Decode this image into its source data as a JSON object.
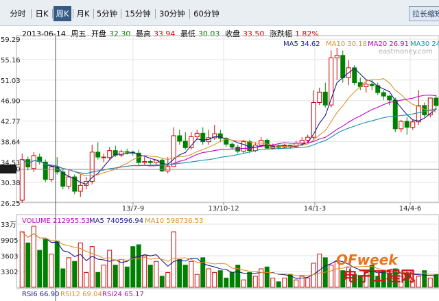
{
  "toolbar": {
    "tabs": [
      {
        "label": "分时",
        "active": false
      },
      {
        "label": "日K",
        "active": false
      },
      {
        "label": "周K",
        "active": true
      },
      {
        "label": "月K",
        "active": false
      },
      {
        "label": "5分钟",
        "active": false
      },
      {
        "label": "15分钟",
        "active": false
      },
      {
        "label": "30分钟",
        "active": false
      },
      {
        "label": "60分钟",
        "active": false
      }
    ],
    "zoom_button": "拉长缩短"
  },
  "info": {
    "date": "2013-06-14",
    "weekday": "周五",
    "open_label": "开盘",
    "open": "32.30",
    "high_label": "最高",
    "high": "33.94",
    "low_label": "最低",
    "low": "30.03",
    "close_label": "收盘",
    "close": "33.50",
    "change_label": "涨跌幅",
    "change": "1.82%"
  },
  "colors": {
    "up": "#d00000",
    "down": "#008000",
    "ma5": "#1a1a8c",
    "ma10": "#e0902a",
    "ma20": "#c000c0",
    "ma30": "#1a8fb0"
  },
  "watermark": {
    "brand": "OFweek",
    "site": "电子工程网",
    "top": "eastmoney.com"
  },
  "chart_data": {
    "type": "candlestick",
    "price_axis": {
      "ticks": [
        "59.29",
        "55.16",
        "51.03",
        "46.90",
        "42.77",
        "38.64",
        "34.51",
        "30.38",
        "26.25"
      ],
      "current": "33.50",
      "ylim": [
        26.25,
        59.29
      ]
    },
    "x_tick_labels": [
      "13/7-9",
      "13/10-12",
      "14/1-3",
      "14/4-6"
    ],
    "legend": [
      {
        "label": "MA5",
        "value": "34.62"
      },
      {
        "label": "MA10",
        "value": "30.18"
      },
      {
        "label": "MA20",
        "value": "26.91"
      },
      {
        "label": "MA30",
        "value": "24"
      }
    ],
    "candles": [
      [
        26.8,
        35.0,
        26.3,
        36.2
      ],
      [
        35.0,
        33.5,
        32.8,
        35.6
      ],
      [
        33.2,
        35.8,
        32.5,
        36.5
      ],
      [
        35.5,
        34.6,
        34.0,
        36.2
      ],
      [
        34.5,
        31.0,
        30.5,
        35.0
      ],
      [
        31.0,
        33.5,
        30.5,
        34.0
      ],
      [
        33.5,
        32.5,
        32.0,
        35.5
      ],
      [
        32.5,
        29.6,
        29.0,
        33.0
      ],
      [
        29.6,
        31.5,
        29.0,
        33.0
      ],
      [
        31.5,
        28.6,
        28.0,
        32.0
      ],
      [
        28.6,
        29.8,
        27.5,
        32.0
      ],
      [
        29.8,
        30.6,
        29.0,
        31.5
      ],
      [
        30.6,
        36.5,
        30.0,
        38.0
      ],
      [
        36.5,
        35.5,
        35.0,
        38.5
      ],
      [
        35.5,
        35.5,
        34.5,
        36.2
      ],
      [
        35.4,
        36.8,
        35.0,
        37.5
      ],
      [
        36.8,
        35.9,
        35.5,
        37.8
      ],
      [
        35.9,
        36.6,
        35.5,
        37.0
      ],
      [
        36.6,
        36.5,
        36.0,
        37.2
      ],
      [
        36.5,
        36.3,
        35.8,
        36.8
      ],
      [
        36.3,
        34.4,
        33.8,
        37.0
      ],
      [
        34.4,
        34.6,
        34.0,
        35.5
      ],
      [
        34.6,
        34.4,
        34.0,
        35.0
      ],
      [
        34.4,
        34.9,
        34.0,
        35.0
      ],
      [
        34.9,
        32.7,
        32.5,
        35.2
      ],
      [
        32.7,
        33.6,
        32.2,
        35.5
      ],
      [
        33.6,
        39.8,
        33.5,
        41.5
      ],
      [
        39.8,
        38.7,
        38.0,
        41.0
      ],
      [
        38.7,
        37.4,
        37.0,
        40.5
      ],
      [
        37.4,
        39.6,
        37.0,
        40.5
      ],
      [
        39.6,
        40.3,
        39.0,
        41.0
      ],
      [
        40.3,
        38.6,
        38.0,
        41.5
      ],
      [
        38.6,
        39.4,
        38.0,
        41.0
      ],
      [
        39.4,
        40.2,
        39.0,
        42.0
      ],
      [
        40.2,
        39.3,
        38.5,
        41.0
      ],
      [
        39.3,
        38.1,
        37.5,
        39.5
      ],
      [
        38.1,
        37.5,
        37.0,
        38.5
      ],
      [
        37.5,
        36.7,
        36.3,
        38.0
      ],
      [
        36.7,
        38.6,
        36.3,
        39.0
      ],
      [
        38.6,
        36.8,
        36.3,
        39.0
      ],
      [
        36.8,
        37.9,
        36.5,
        38.5
      ],
      [
        37.9,
        38.9,
        37.5,
        39.5
      ],
      [
        38.9,
        37.3,
        37.0,
        39.2
      ],
      [
        37.3,
        37.6,
        37.0,
        38.2
      ],
      [
        37.6,
        37.5,
        37.0,
        38.0
      ],
      [
        37.5,
        37.9,
        37.2,
        38.2
      ],
      [
        37.9,
        37.6,
        37.2,
        38.0
      ],
      [
        37.6,
        38.3,
        37.3,
        38.8
      ],
      [
        38.3,
        38.9,
        38.0,
        39.5
      ],
      [
        38.9,
        39.5,
        38.5,
        40.0
      ],
      [
        39.5,
        46.5,
        39.0,
        49.0
      ],
      [
        46.5,
        48.6,
        46.0,
        49.5
      ],
      [
        48.6,
        46.0,
        45.5,
        50.5
      ],
      [
        46.0,
        55.5,
        45.5,
        57.0
      ],
      [
        55.5,
        56.0,
        51.0,
        57.5
      ],
      [
        56.0,
        51.5,
        50.5,
        57.0
      ],
      [
        51.5,
        53.5,
        50.0,
        55.0
      ],
      [
        53.5,
        50.5,
        50.0,
        54.0
      ],
      [
        50.5,
        49.7,
        49.0,
        51.5
      ],
      [
        49.7,
        50.2,
        48.5,
        51.0
      ],
      [
        50.2,
        49.9,
        49.0,
        51.0
      ],
      [
        49.9,
        48.5,
        48.0,
        50.5
      ],
      [
        48.5,
        47.8,
        47.0,
        49.0
      ],
      [
        47.8,
        47.0,
        46.0,
        48.0
      ],
      [
        47.0,
        41.2,
        40.5,
        47.5
      ],
      [
        41.2,
        42.7,
        40.5,
        43.0
      ],
      [
        42.7,
        41.5,
        40.0,
        43.5
      ],
      [
        41.5,
        42.6,
        41.0,
        43.0
      ],
      [
        42.6,
        45.9,
        42.0,
        49.0
      ],
      [
        45.9,
        44.0,
        43.5,
        46.5
      ],
      [
        44.0,
        47.4,
        43.5,
        47.5
      ],
      [
        47.4,
        45.9,
        45.0,
        48.0
      ]
    ],
    "volume": {
      "legend": [
        {
          "label": "VOLUME",
          "value": "212955.53"
        },
        {
          "label": "MA5",
          "value": "740596.94"
        },
        {
          "label": "MA10",
          "value": "598736.53"
        }
      ],
      "ticks": [
        "33万",
        "9905",
        "3603",
        "3302"
      ],
      "values": [
        30,
        24,
        33,
        20,
        26,
        18,
        25,
        10,
        16,
        14,
        24,
        8,
        22,
        8,
        12,
        20,
        12,
        15,
        11,
        22,
        23,
        17,
        12,
        14,
        6,
        8,
        30,
        15,
        12,
        14,
        7,
        16,
        10,
        8,
        9,
        5,
        8,
        12,
        4,
        8,
        6,
        10,
        11,
        5,
        3,
        5,
        7,
        4,
        6,
        5,
        13,
        18,
        16,
        12,
        14,
        9,
        11,
        7,
        6,
        8,
        12,
        6,
        9,
        7,
        10,
        6,
        8,
        4,
        6,
        9,
        5,
        7
      ]
    },
    "rsi_legend": [
      {
        "label": "RSI6",
        "value": "66.90"
      },
      {
        "label": "RSI12",
        "value": "69.04"
      },
      {
        "label": "RSI24",
        "value": "65.17"
      }
    ]
  }
}
